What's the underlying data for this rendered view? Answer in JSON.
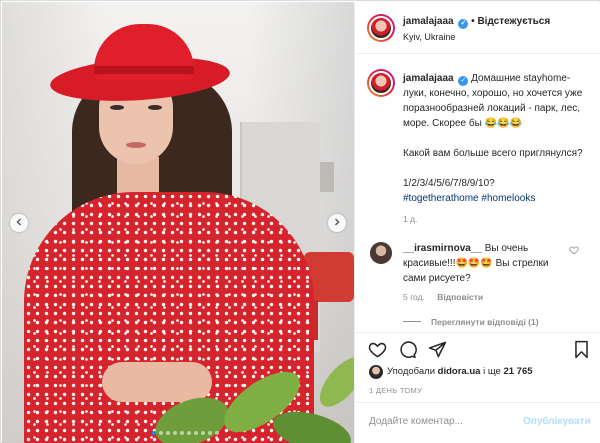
{
  "post": {
    "username": "jamalajaaa",
    "follow_status": "Відстежується",
    "location": "Kyiv, Ukraine",
    "verified_icon": "verified-badge-icon"
  },
  "caption": {
    "username": "jamalajaaa",
    "line1": "Домашние stayhome-луки, конечно, хорошо, но хочется уже поразнообразней локаций - парк, лес, море. Скорее бы 😂😂😂",
    "line2": "Какой вам больше всего приглянулся?",
    "line3": "1/2/3/4/5/6/7/8/9/10?",
    "hashtag1": "#togetherathome",
    "hashtag2": "#homelooks",
    "time": "1 д."
  },
  "comment": {
    "username": "__irasmirnova__",
    "text": "Вы очень красивые!!!🤩🤩🤩 Вы стрелки сами рисуете?",
    "time": "5 год.",
    "reply_label": "Відповісти",
    "view_replies": "Переглянути відповіді (1)"
  },
  "likes": {
    "prefix": "Уподобали",
    "user": "didora.ua",
    "middle": "і ще",
    "count": "21 765"
  },
  "post_date": "1 ДЕНЬ ТОМУ",
  "composer": {
    "placeholder": "Додайте коментар...",
    "publish_label": "Опублікувати"
  },
  "carousel": {
    "total_slides": 10,
    "active_slide": 1
  },
  "colors": {
    "accent": "#0095f6",
    "verified": "#3897f0",
    "hat": "#e01f2b",
    "dress": "#d6242c"
  }
}
